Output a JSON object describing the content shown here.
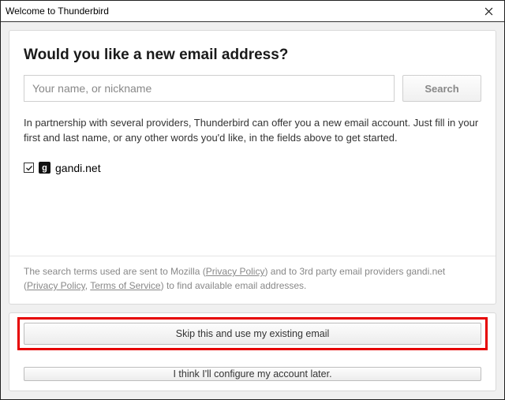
{
  "window": {
    "title": "Welcome to Thunderbird"
  },
  "main": {
    "heading": "Would you like a new email address?",
    "name_placeholder": "Your name, or nickname",
    "name_value": "",
    "search_label": "Search",
    "description": "In partnership with several providers, Thunderbird can offer you a new email account. Just fill in your first and last name, or any other words you'd like, in the fields above to get started.",
    "providers": [
      {
        "label": "gandi.net",
        "checked": true,
        "logo_letter": "g"
      }
    ],
    "legal_pre": "The search terms used are sent to Mozilla (",
    "legal_privacy": "Privacy Policy",
    "legal_mid1": ") and to 3rd party email providers gandi.net (",
    "legal_tos": "Terms of Service",
    "legal_mid2": ", ",
    "legal_post": ") to find available email addresses."
  },
  "buttons": {
    "skip": "Skip this and use my existing email",
    "later": "I think I'll configure my account later."
  }
}
